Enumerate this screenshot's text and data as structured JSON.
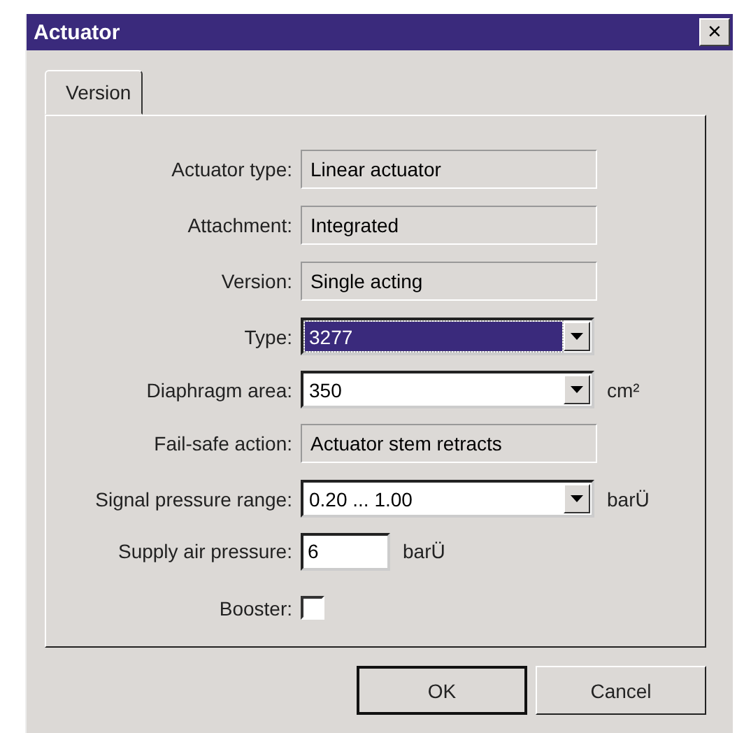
{
  "window": {
    "title": "Actuator",
    "close": "×"
  },
  "tabs": [
    {
      "label": "Version",
      "selected": true
    }
  ],
  "fields": [
    {
      "kind": "readonly",
      "label": "Actuator type:",
      "value": "Linear actuator"
    },
    {
      "kind": "readonly",
      "label": "Attachment:",
      "value": "Integrated"
    },
    {
      "kind": "readonly",
      "label": "Version:",
      "value": "Single acting"
    },
    {
      "kind": "combo",
      "label": "Type:",
      "value": "3277",
      "highlighted": true
    },
    {
      "kind": "combo",
      "label": "Diaphragm area:",
      "value": "350",
      "unit": "cm²",
      "highlighted": false
    },
    {
      "kind": "readonly",
      "label": "Fail-safe action:",
      "value": "Actuator stem retracts"
    },
    {
      "kind": "combo",
      "label": "Signal pressure range:",
      "value": "0.20 ... 1.00",
      "unit": "barÜ",
      "highlighted": false
    },
    {
      "kind": "input",
      "label": "Supply air pressure:",
      "value": "6",
      "unit": "barÜ"
    },
    {
      "kind": "checkbox",
      "label": "Booster:",
      "checked": false
    }
  ],
  "buttons": [
    "OK",
    "Cancel"
  ]
}
